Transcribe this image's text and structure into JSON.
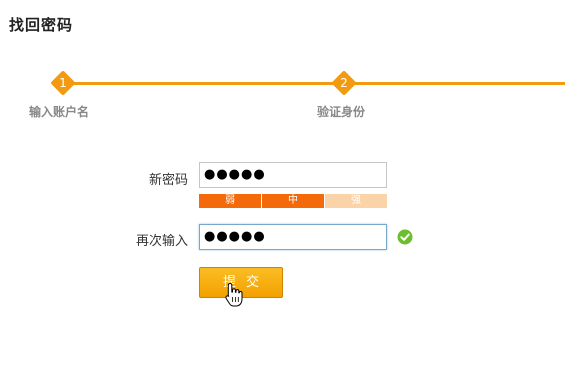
{
  "page": {
    "title": "找回密码"
  },
  "steps": [
    {
      "number": "1",
      "label": "输入账户名"
    },
    {
      "number": "2",
      "label": "验证身份"
    }
  ],
  "form": {
    "new_password": {
      "label": "新密码",
      "value": "●●●●●"
    },
    "strength": {
      "levels": [
        "弱",
        "中",
        "强"
      ],
      "active_level_count": 2,
      "active_color": "#f46a0a",
      "inactive_color": "#fbd3a8"
    },
    "confirm_password": {
      "label": "再次输入",
      "value": "●●●●●",
      "valid": true
    },
    "submit_label": "提交"
  },
  "colors": {
    "accent": "#f39b10",
    "success": "#6cbe2f"
  },
  "icons": {
    "check": "check-circle-icon",
    "cursor": "hand-pointer-icon"
  }
}
